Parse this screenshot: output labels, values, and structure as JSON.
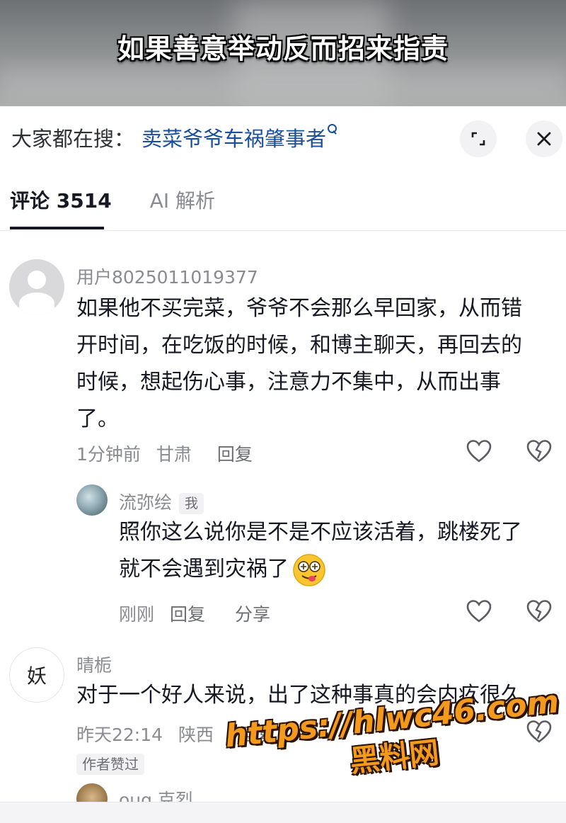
{
  "video": {
    "title": "如果善意举动反而招来指责"
  },
  "search": {
    "label": "大家都在搜：",
    "term": "卖菜爷爷车祸肇事者"
  },
  "tabs": [
    {
      "label": "评论 3514",
      "active": true
    },
    {
      "label": "AI 解析",
      "active": false
    }
  ],
  "comments": [
    {
      "user": "用户8025011019377",
      "lines": [
        "如果他不买完菜，爷爷不会那么早回家，从而错",
        "开时间，在吃饭的时候，和博主聊天，再回去的",
        "时候，想起伤心事，注意力不集中，从而出事",
        "了。"
      ],
      "time": "1分钟前",
      "location": "甘肃",
      "reply_label": "回复"
    },
    {
      "user": "流弥绘",
      "badge": "我",
      "lines": [
        "照你这么说你是不是不应该活着，跳楼死了",
        "就不会遇到灾祸了"
      ],
      "time": "刚刚",
      "reply_label": "回复",
      "share_label": "分享"
    },
    {
      "user": "晴栀",
      "avatar_text": "妖",
      "lines": [
        "对于一个好人来说，出了这种事真的会内疚很久"
      ],
      "time": "昨天22:14",
      "location": "陕西",
      "reply_label": "回复",
      "liked_badge": "作者赞过"
    },
    {
      "user": "oug 克烈"
    }
  ],
  "watermark": {
    "url": "https://hlwc46.com",
    "name": "黑料网"
  },
  "colors": {
    "accent_link": "#1a4f9e",
    "watermark": "#f39a1e",
    "text_primary": "#161823",
    "text_secondary": "#8a8b91"
  }
}
